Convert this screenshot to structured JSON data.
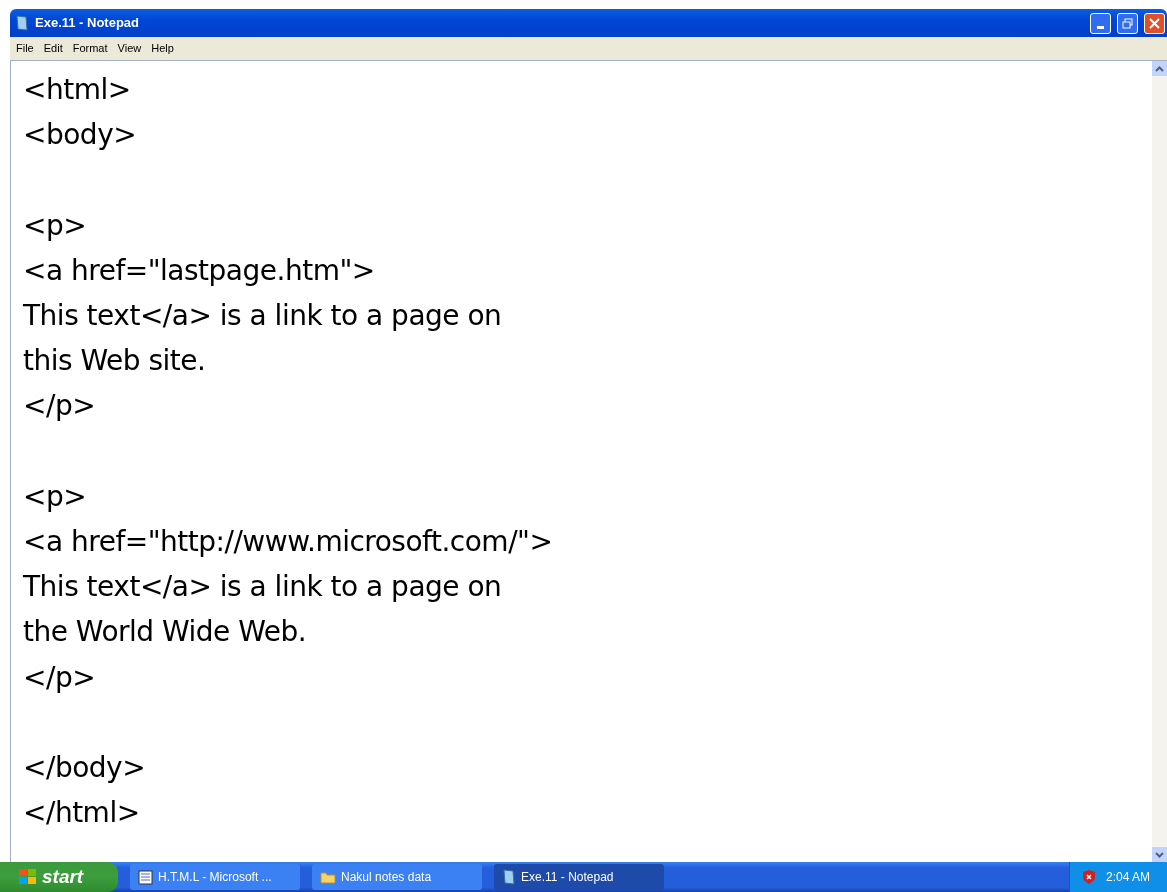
{
  "window": {
    "title": "Exe.11 - Notepad"
  },
  "menu": [
    "File",
    "Edit",
    "Format",
    "View",
    "Help"
  ],
  "editor": {
    "blocks": [
      [
        "<html>",
        "<body>"
      ],
      [
        "<p>",
        "<a href=\"lastpage.htm\">",
        "This text</a> is a link to a page on",
        "this Web site.",
        "</p>"
      ],
      [
        "<p>",
        "<a href=\"http://www.microsoft.com/\">",
        "This text</a> is a link to a page on",
        "the World Wide Web.",
        "</p>"
      ],
      [
        "</body>",
        "</html>"
      ]
    ]
  },
  "taskbar": {
    "start": "start",
    "tasks": [
      {
        "label": "H.T.M.L - Microsoft ...",
        "kind": "document",
        "selected": false
      },
      {
        "label": "Nakul notes data",
        "kind": "folder",
        "selected": false
      },
      {
        "label": "Exe.11 - Notepad",
        "kind": "notepad",
        "selected": true
      }
    ],
    "clock": "2:04 AM"
  }
}
